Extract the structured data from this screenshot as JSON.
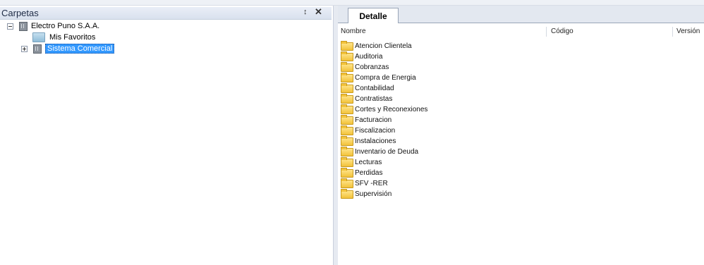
{
  "panel": {
    "title": "Carpetas",
    "pin_icon": "pin-icon",
    "close_icon": "close-icon"
  },
  "tree": [
    {
      "label": "Electro Puno S.A.A.",
      "icon": "building-icon",
      "expander": "collapse"
    },
    {
      "label": "Mis Favoritos",
      "icon": "favorites-folder-icon"
    },
    {
      "label": "Sistema Comercial",
      "icon": "building-icon",
      "expander": "expand",
      "selected": true
    }
  ],
  "tabs": [
    {
      "label": "Detalle",
      "active": true
    }
  ],
  "columns": {
    "name": "Nombre",
    "code": "Código",
    "version": "Versión"
  },
  "items": [
    "Atencion Clientela",
    "Auditoria",
    "Cobranzas",
    "Compra de Energia",
    "Contabilidad",
    "Contratistas",
    "Cortes y Reconexiones",
    "Facturacion",
    "Fiscalizacion",
    "Instalaciones",
    "Inventario de Deuda",
    "Lecturas",
    "Perdidas",
    "SFV -RER",
    "Supervisión"
  ]
}
